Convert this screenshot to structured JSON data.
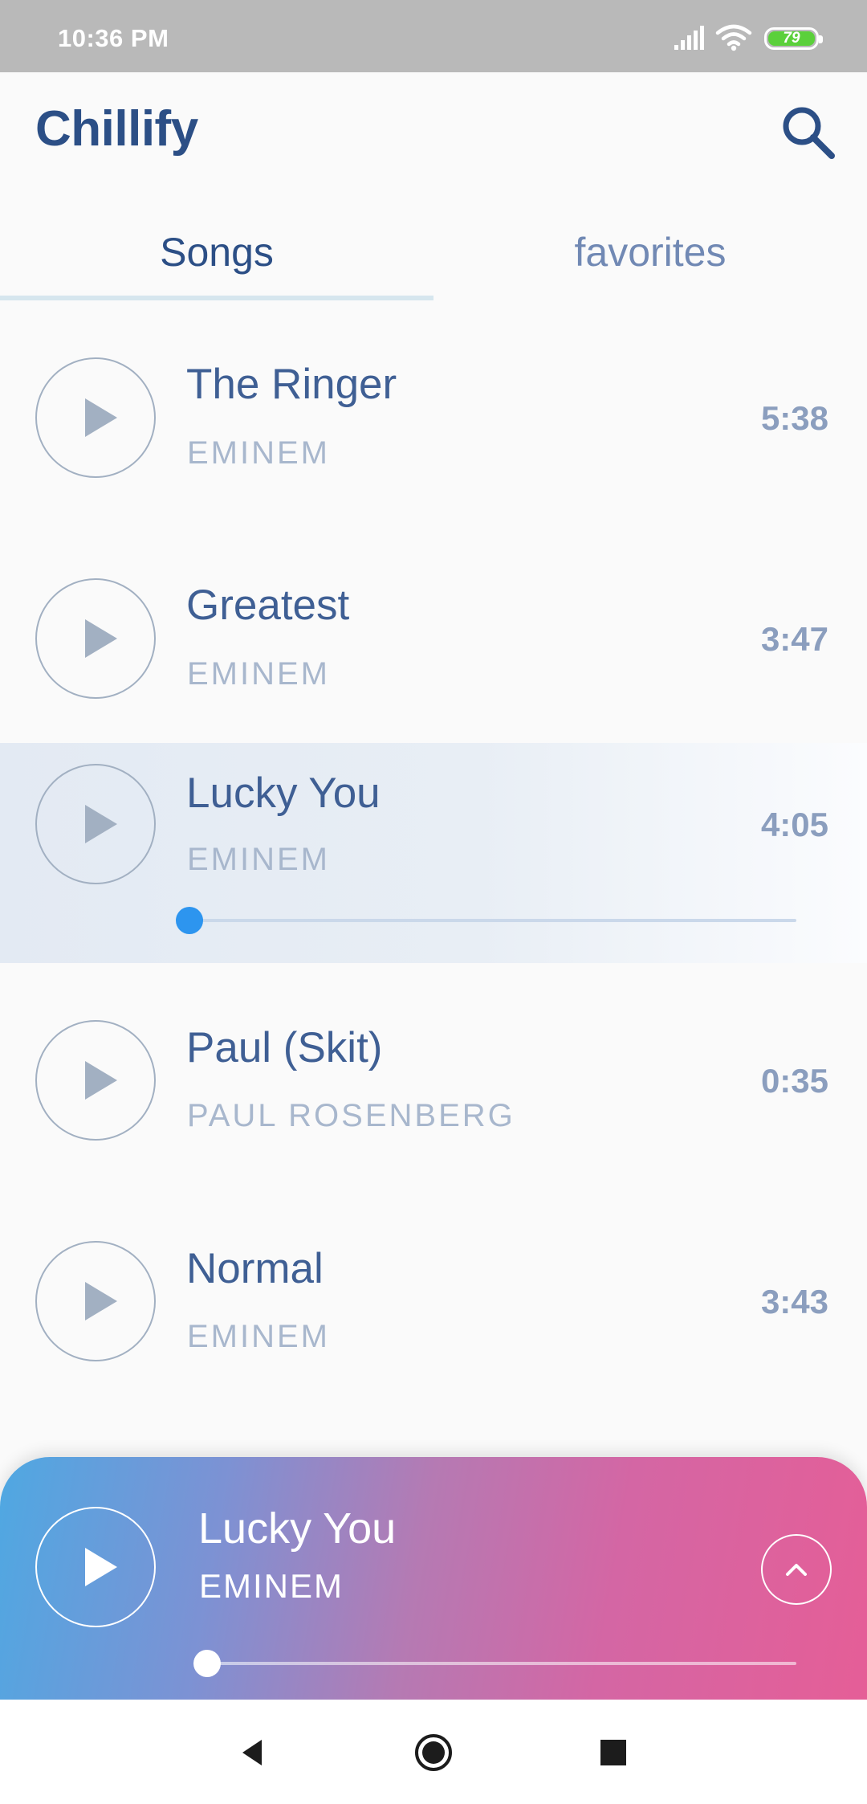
{
  "status_bar": {
    "time": "10:36 PM",
    "battery_level": "79",
    "icons": [
      "signal-icon",
      "wifi-icon",
      "battery-icon"
    ]
  },
  "app": {
    "title": "Chillify",
    "search_icon": "search-icon"
  },
  "tabs": [
    {
      "label": "Songs",
      "selected": true
    },
    {
      "label": "favorites",
      "selected": false
    }
  ],
  "songs": [
    {
      "title": "The Ringer",
      "artist": "EMINEM",
      "duration": "5:38"
    },
    {
      "title": "Greatest",
      "artist": "EMINEM",
      "duration": "3:47"
    },
    {
      "title": "Lucky You",
      "artist": "EMINEM",
      "duration": "4:05",
      "active": true,
      "progress": 0.0
    },
    {
      "title": "Paul (Skit)",
      "artist": "PAUL ROSENBERG",
      "duration": "0:35"
    },
    {
      "title": "Normal",
      "artist": "EMINEM",
      "duration": "3:43"
    }
  ],
  "now_playing": {
    "title": "Lucky You",
    "artist": "EMINEM",
    "progress": 0.0
  },
  "colors": {
    "accent": "#2d95ef",
    "title": "#2c4f86",
    "gradient_start": "#4fa8e2",
    "gradient_end": "#e55e97"
  },
  "nav_bar": {
    "icons": [
      "back-icon",
      "home-icon",
      "recents-icon"
    ]
  }
}
